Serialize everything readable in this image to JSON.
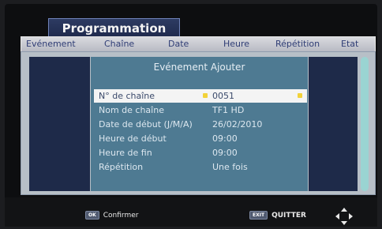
{
  "window": {
    "title": "Programmation"
  },
  "header": {
    "columns": [
      "Evénement",
      "Chaîne",
      "Date",
      "Heure",
      "Répétition",
      "Etat"
    ]
  },
  "dialog": {
    "title": "Evénement Ajouter",
    "fields": [
      {
        "label": "N° de chaîne",
        "value": "0051",
        "selected": true
      },
      {
        "label": "Nom de chaîne",
        "value": "TF1 HD"
      },
      {
        "label": "Date de début (J/M/A)",
        "value": "26/02/2010"
      },
      {
        "label": "Heure de début",
        "value": "09:00"
      },
      {
        "label": "Heure de fin",
        "value": "09:00"
      },
      {
        "label": "Répétition",
        "value": "Une fois"
      }
    ]
  },
  "footer": {
    "ok_key": "OK",
    "ok_label": "Confirmer",
    "exit_key": "EXIT",
    "exit_label": "QUITTER",
    "nav_icon": "dpad-arrows-icon"
  },
  "colors": {
    "dialog_bg": "#4e7a92",
    "selection_bg": "#f4f4f4",
    "marker": "#f2d23a",
    "column_bg": "#1e2a49"
  }
}
